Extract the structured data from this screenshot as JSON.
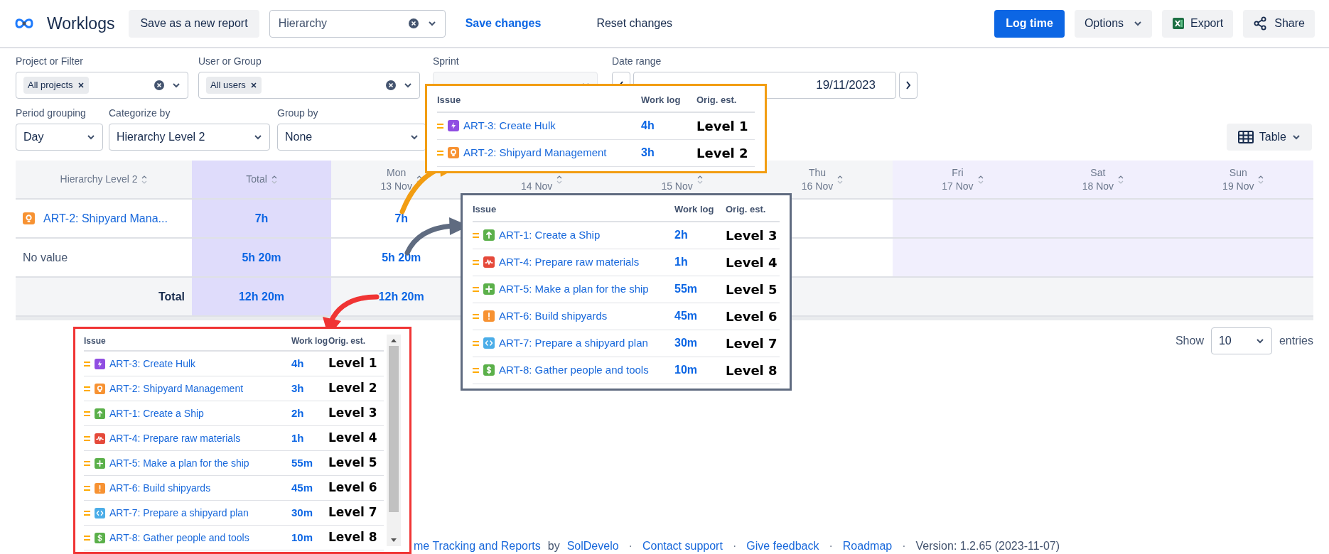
{
  "header": {
    "title": "Worklogs",
    "save_as_button": "Save as a new report",
    "report_select": {
      "value": "Hierarchy"
    },
    "save_changes": "Save changes",
    "reset_changes": "Reset changes",
    "log_time": "Log time",
    "options": "Options",
    "export": "Export",
    "share": "Share"
  },
  "filters": {
    "project": {
      "label": "Project or Filter",
      "chip": "All projects"
    },
    "user": {
      "label": "User or Group",
      "chip": "All users"
    },
    "sprint": {
      "label": "Sprint",
      "disabled": true
    },
    "date_range": {
      "label": "Date range",
      "end": "19/11/2023"
    },
    "period_grouping": {
      "label": "Period grouping",
      "value": "Day"
    },
    "categorize_by": {
      "label": "Categorize by",
      "value": "Hierarchy Level 2"
    },
    "group_by": {
      "label": "Group by",
      "value": "None"
    }
  },
  "view_button": "Table",
  "table": {
    "columns": [
      {
        "kind": "category",
        "label": "Hierarchy Level 2"
      },
      {
        "kind": "total",
        "label": "Total"
      },
      {
        "kind": "day",
        "day": "Mon",
        "date": "13 Nov",
        "highlighted": false
      },
      {
        "kind": "day",
        "date": "14 Nov"
      },
      {
        "kind": "day",
        "date": "15 Nov"
      },
      {
        "kind": "day",
        "day": "Thu",
        "date": "16 Nov",
        "highlighted": false
      },
      {
        "kind": "day",
        "day": "Fri",
        "date": "17 Nov",
        "highlighted": true
      },
      {
        "kind": "day",
        "day": "Sat",
        "date": "18 Nov",
        "highlighted": true
      },
      {
        "kind": "day",
        "day": "Sun",
        "date": "19 Nov",
        "highlighted": true
      }
    ],
    "rows": [
      {
        "kind": "idea",
        "label": "ART-2: Shipyard Mana...",
        "total": "7h",
        "days": [
          "7h"
        ]
      },
      {
        "kind": "plain",
        "label": "No value",
        "total": "5h 20m",
        "days": [
          "5h 20m"
        ]
      },
      {
        "kind": "total",
        "label": "Total",
        "total": "12h 20m",
        "days": [
          "12h 20m"
        ]
      }
    ]
  },
  "pagination": {
    "show": "Show",
    "page_size": "10",
    "entries": "entries"
  },
  "footer": [
    {
      "kind": "link",
      "text": "me Tracking and Reports"
    },
    {
      "kind": "text",
      "text": "by"
    },
    {
      "kind": "link",
      "text": "SolDevelo"
    },
    {
      "kind": "separator",
      "text": "·"
    },
    {
      "kind": "link",
      "text": "Contact support"
    },
    {
      "kind": "separator",
      "text": "·"
    },
    {
      "kind": "link",
      "text": "Give feedback"
    },
    {
      "kind": "separator",
      "text": "·"
    },
    {
      "kind": "link",
      "text": "Roadmap"
    },
    {
      "kind": "separator",
      "text": "·"
    },
    {
      "kind": "text",
      "text": "Version: 1.2.65 (2023-11-07)"
    }
  ],
  "callouts": [
    {
      "color": "#f29d12",
      "scrollbar": false,
      "columns": [
        "Issue",
        "Work log",
        "Orig. est."
      ],
      "rows": [
        {
          "kind": "epic",
          "title": "ART-3: Create Hulk",
          "work_log": "4h",
          "annotation": "Level 1"
        },
        {
          "kind": "idea",
          "title": "ART-2: Shipyard Management",
          "work_log": "3h",
          "annotation": "Level 2"
        }
      ]
    },
    {
      "color": "#5f6b80",
      "scrollbar": false,
      "columns": [
        "Issue",
        "Work log",
        "Orig. est."
      ],
      "rows": [
        {
          "kind": "improvement",
          "title": "ART-1: Create a Ship",
          "work_log": "2h",
          "annotation": "Level 3"
        },
        {
          "kind": "bug",
          "title": "ART-4: Prepare raw materials",
          "work_log": "1h",
          "annotation": "Level 4"
        },
        {
          "kind": "new_feature",
          "title": "ART-5: Make a plan for the ship",
          "work_log": "55m",
          "annotation": "Level 5"
        },
        {
          "kind": "alert",
          "title": "ART-6: Build shipyards",
          "work_log": "45m",
          "annotation": "Level 6"
        },
        {
          "kind": "code",
          "title": "ART-7: Prepare a shipyard plan",
          "work_log": "30m",
          "annotation": "Level 7"
        },
        {
          "kind": "cost",
          "title": "ART-8: Gather people and tools",
          "work_log": "10m",
          "annotation": "Level 8"
        }
      ]
    },
    {
      "color": "#f03434",
      "scrollbar": true,
      "columns": [
        "Issue",
        "Work log",
        "Orig. est."
      ],
      "rows": [
        {
          "kind": "epic",
          "title": "ART-3: Create Hulk",
          "work_log": "4h",
          "annotation": "Level 1"
        },
        {
          "kind": "idea",
          "title": "ART-2: Shipyard Management",
          "work_log": "3h",
          "annotation": "Level 2"
        },
        {
          "kind": "improvement",
          "title": "ART-1: Create a Ship",
          "work_log": "2h",
          "annotation": "Level 3"
        },
        {
          "kind": "bug",
          "title": "ART-4: Prepare raw materials",
          "work_log": "1h",
          "annotation": "Level 4"
        },
        {
          "kind": "new_feature",
          "title": "ART-5: Make a plan for the ship",
          "work_log": "55m",
          "annotation": "Level 5"
        },
        {
          "kind": "alert",
          "title": "ART-6: Build shipyards",
          "work_log": "45m",
          "annotation": "Level 6"
        },
        {
          "kind": "code",
          "title": "ART-7: Prepare a shipyard plan",
          "work_log": "30m",
          "annotation": "Level 7"
        },
        {
          "kind": "cost",
          "title": "ART-8: Gather people and tools",
          "work_log": "10m",
          "annotation": "Level 8"
        }
      ]
    }
  ]
}
